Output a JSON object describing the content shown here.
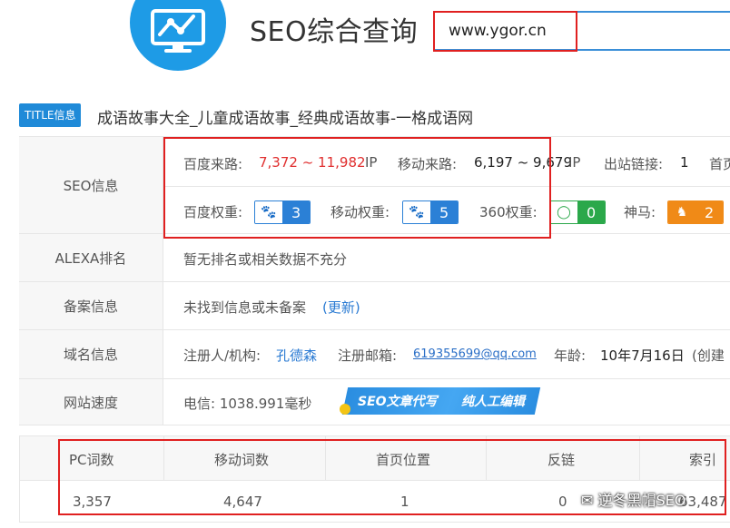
{
  "header": {
    "app_title": "SEO综合查询",
    "search_value": "www.ygor.cn",
    "logo_icon": "monitor-chart-icon"
  },
  "title_line": {
    "badge": "TITLE信息",
    "site_title": "成语故事大全_儿童成语故事_经典成语故事-一格成语网"
  },
  "seo_info": {
    "label": "SEO信息",
    "baidu_traffic_label": "百度来路:",
    "baidu_traffic_value": "7,372 ~ 11,982",
    "baidu_traffic_unit": "IP",
    "mobile_traffic_label": "移动来路:",
    "mobile_traffic_value": "6,197 ~ 9,679",
    "mobile_traffic_unit": "IP",
    "outbound_label": "出站链接:",
    "outbound_value": "1",
    "homepage_label": "首页",
    "baidu_weight_label": "百度权重:",
    "baidu_weight_value": "3",
    "mobile_weight_label": "移动权重:",
    "mobile_weight_value": "5",
    "weight_360_label": "360权重:",
    "weight_360_value": "0",
    "shenma_label": "神马:",
    "shenma_value": "2"
  },
  "alexa": {
    "label": "ALEXA排名",
    "value": "暂无排名或相关数据不充分"
  },
  "icp": {
    "label": "备案信息",
    "value": "未找到信息或未备案",
    "refresh_link": "(更新)"
  },
  "domain": {
    "label": "域名信息",
    "registrant_label": "注册人/机构:",
    "registrant_value": "孔德森",
    "email_label": "注册邮箱:",
    "email_value": "619355699@qq.com",
    "age_label": "年龄:",
    "age_value": "10年7月16日",
    "created_label": "(创建"
  },
  "speed": {
    "label": "网站速度",
    "value": "电信: 1038.991毫秒",
    "banner_left": "SEO文章代写",
    "banner_right": "纯人工编辑"
  },
  "keywords_table": {
    "headers": [
      "PC词数",
      "移动词数",
      "首页位置",
      "反链",
      "索引"
    ],
    "values": [
      "3,357",
      "4,647",
      "1",
      "0",
      "63,487"
    ]
  },
  "watermark": "逆冬黑帽SEO",
  "colors": {
    "accent_blue": "#1e9be6",
    "highlight_red": "#e02020",
    "traffic_red": "#e02f2f",
    "badge_green": "#2ba84a",
    "badge_orange": "#f08a17"
  }
}
